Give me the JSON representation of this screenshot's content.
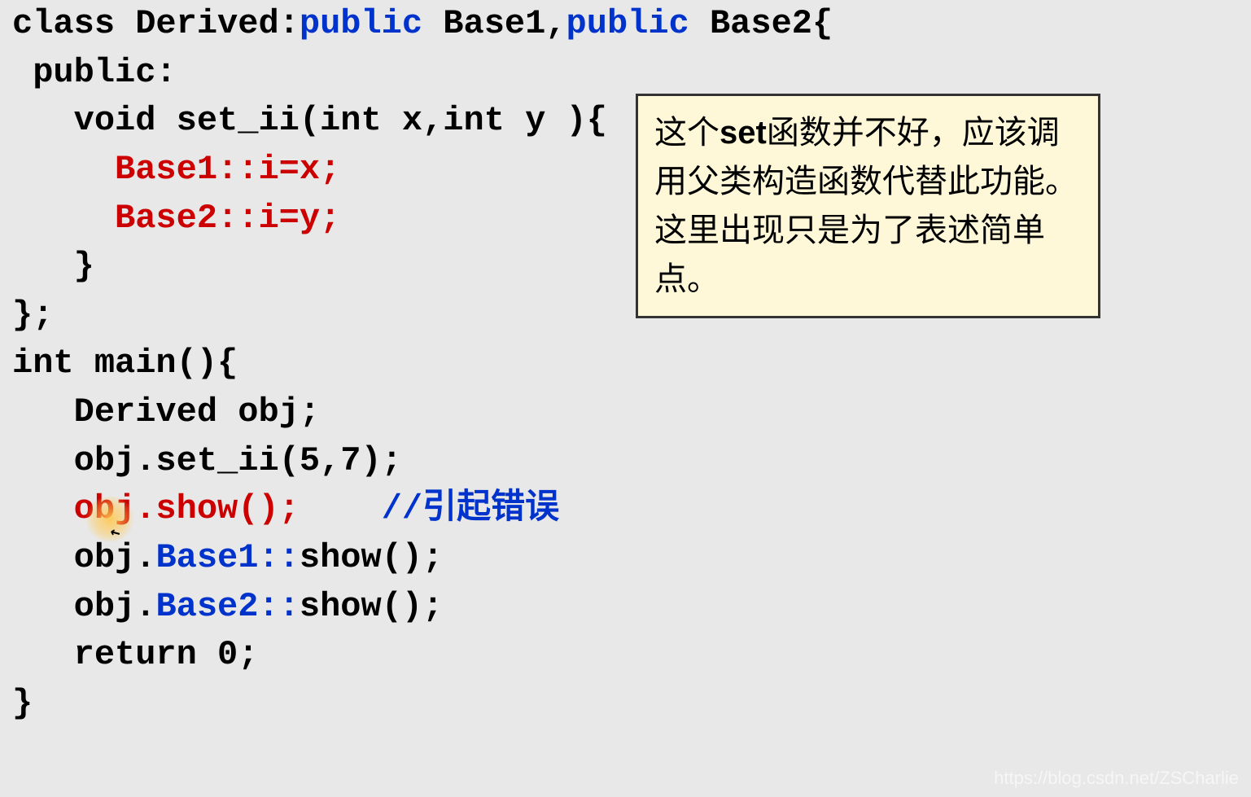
{
  "code": {
    "line1_part1": "class Derived:",
    "line1_public1": "public",
    "line1_base1": " Base1,",
    "line1_public2": "public",
    "line1_base2": " Base2{",
    "line2": " public:",
    "line3": "   void set_ii(int x,int y ){",
    "line4_red": "     Base1::i=x;",
    "line5_red": "     Base2::i=y;",
    "line6": "   }",
    "line7": "};",
    "line8": "int main(){",
    "line9": "   Derived obj;",
    "line10": "   obj.set_ii(5,7);",
    "line11_red": "   obj.show();",
    "line11_space": "    ",
    "line11_comment": "//引起错误",
    "line12_part1": "   obj.",
    "line12_blue": "Base1::",
    "line12_part2": "show();",
    "line13_part1": "   obj.",
    "line13_blue": "Base2::",
    "line13_part2": "show();",
    "line14": "   return 0;",
    "line15": "}"
  },
  "annotation": {
    "part1": "这个",
    "bold": "set",
    "part2": "函数并不好，应该调用父类构造函数代替此功能。这里出现只是为了表述简单点。"
  },
  "watermark": "https://blog.csdn.net/ZSCharlie"
}
